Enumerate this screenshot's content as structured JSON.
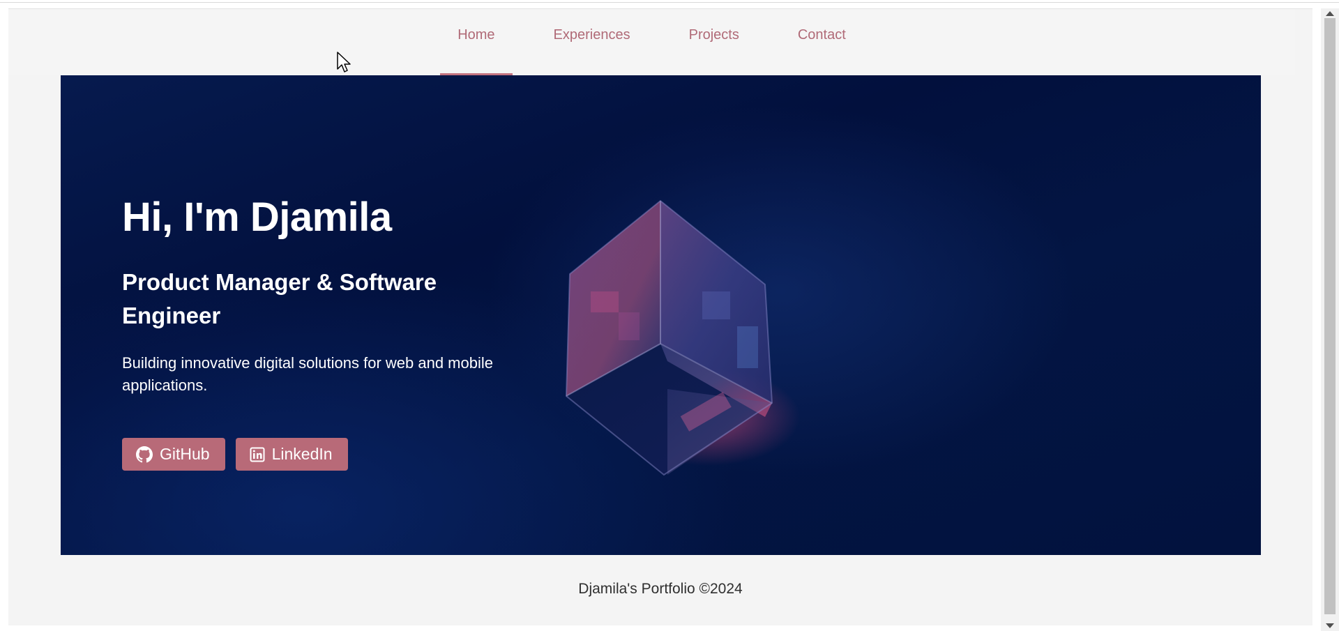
{
  "nav": {
    "items": [
      {
        "label": "Home",
        "active": true
      },
      {
        "label": "Experiences",
        "active": false
      },
      {
        "label": "Projects",
        "active": false
      },
      {
        "label": "Contact",
        "active": false
      }
    ]
  },
  "hero": {
    "title": "Hi, I'm Djamila",
    "subtitle": "Product Manager & Software Engineer",
    "description": "Building innovative digital solutions for web and mobile applications.",
    "buttons": {
      "github_label": "GitHub",
      "linkedin_label": "LinkedIn"
    },
    "image_icon": "glass-cube-image"
  },
  "footer": {
    "text": "Djamila's Portfolio ©2024"
  },
  "colors": {
    "accent": "#b86a78",
    "nav_text": "#b06a77",
    "hero_bg": "#02103d",
    "page_bg": "#f4f4f4"
  }
}
